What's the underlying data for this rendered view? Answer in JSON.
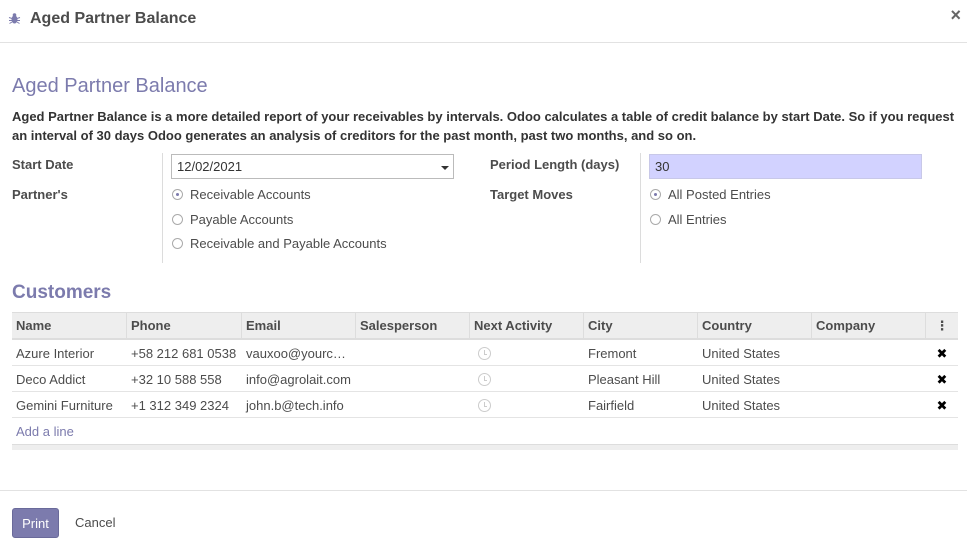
{
  "modal": {
    "title": "Aged Partner Balance",
    "close": "×"
  },
  "form": {
    "title": "Aged Partner Balance",
    "description": "Aged Partner Balance is a more detailed report of your receivables by intervals. Odoo calculates a table of credit balance by start Date. So if you request an interval of 30 days Odoo generates an analysis of creditors for the past month, past two months, and so on.",
    "start_date_label": "Start Date",
    "start_date_value": "12/02/2021",
    "partners_label": "Partner's",
    "partner_options": [
      "Receivable Accounts",
      "Payable Accounts",
      "Receivable and Payable Accounts"
    ],
    "partner_selected": 0,
    "period_length_label": "Period Length (days)",
    "period_length_value": "30",
    "target_moves_label": "Target Moves",
    "target_options": [
      "All Posted Entries",
      "All Entries"
    ],
    "target_selected": 0
  },
  "customers": {
    "title": "Customers",
    "columns": [
      "Name",
      "Phone",
      "Email",
      "Salesperson",
      "Next Activity",
      "City",
      "Country",
      "Company"
    ],
    "rows": [
      {
        "name": "Azure Interior",
        "phone": "+58 212 681 0538",
        "email": "vauxoo@yourc…",
        "salesperson": "",
        "city": "Fremont",
        "country": "United States",
        "company": ""
      },
      {
        "name": "Deco Addict",
        "phone": "+32 10 588 558",
        "email": "info@agrolait.com",
        "salesperson": "",
        "city": "Pleasant Hill",
        "country": "United States",
        "company": ""
      },
      {
        "name": "Gemini Furniture",
        "phone": "+1 312 349 2324",
        "email": "john.b@tech.info",
        "salesperson": "",
        "city": "Fairfield",
        "country": "United States",
        "company": ""
      }
    ],
    "add_line": "Add a line",
    "delete_glyph": "✖",
    "options_glyph": "⋮"
  },
  "footer": {
    "print_label": "Print",
    "cancel_label": "Cancel"
  },
  "colors": {
    "accent": "#7c7bad",
    "highlight_input": "#d2d2ff"
  }
}
